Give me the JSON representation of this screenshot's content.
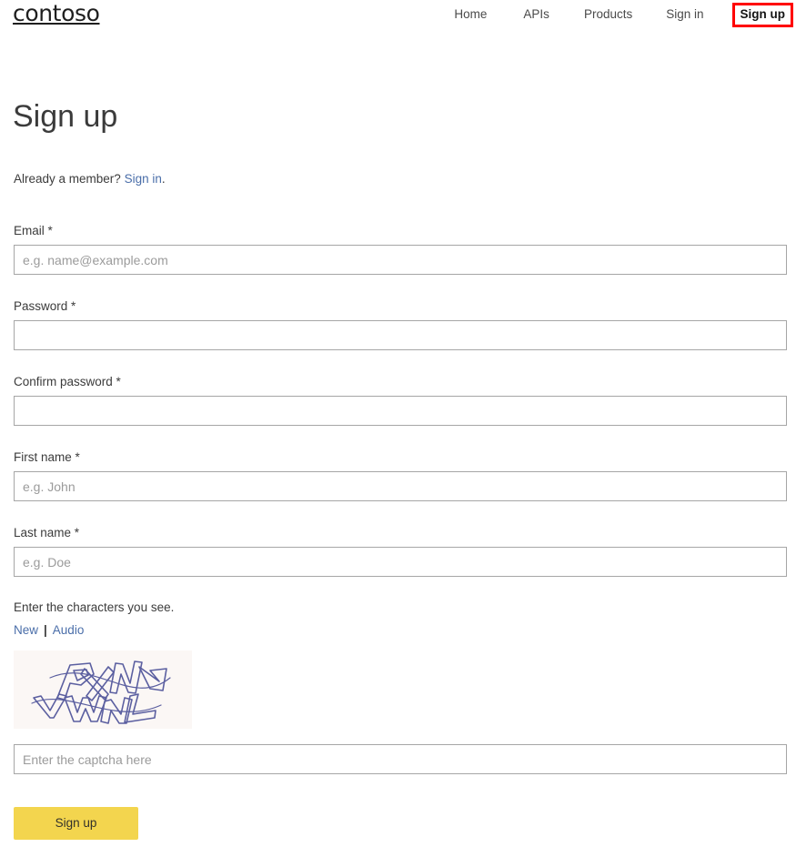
{
  "header": {
    "brand": "contoso",
    "nav": [
      {
        "label": "Home",
        "highlighted": false
      },
      {
        "label": "APIs",
        "highlighted": false
      },
      {
        "label": "Products",
        "highlighted": false
      },
      {
        "label": "Sign in",
        "highlighted": false
      },
      {
        "label": "Sign up",
        "highlighted": true
      }
    ]
  },
  "page": {
    "title": "Sign up",
    "member_prompt_prefix": "Already a member? ",
    "member_prompt_link": "Sign in",
    "member_prompt_suffix": "."
  },
  "form": {
    "email": {
      "label": "Email *",
      "placeholder": "e.g. name@example.com",
      "value": ""
    },
    "password": {
      "label": "Password *",
      "placeholder": "",
      "value": ""
    },
    "confirm_password": {
      "label": "Confirm password *",
      "placeholder": "",
      "value": ""
    },
    "first_name": {
      "label": "First name *",
      "placeholder": "e.g. John",
      "value": ""
    },
    "last_name": {
      "label": "Last name *",
      "placeholder": "e.g. Doe",
      "value": ""
    },
    "captcha": {
      "instruction": "Enter the characters you see.",
      "new_link": "New",
      "separator": "|",
      "audio_link": "Audio",
      "image_text": "PXN YWNL",
      "input_placeholder": "Enter the captcha here",
      "input_value": ""
    },
    "submit_label": "Sign up"
  },
  "colors": {
    "accent_button": "#f3d54e",
    "link": "#4a6ea9",
    "highlight_outline": "#ff0000",
    "input_border": "#a6a6a6",
    "captcha_bg": "#fbf7f5",
    "captcha_ink": "#5b5fa0",
    "text": "#3b3b3b"
  }
}
